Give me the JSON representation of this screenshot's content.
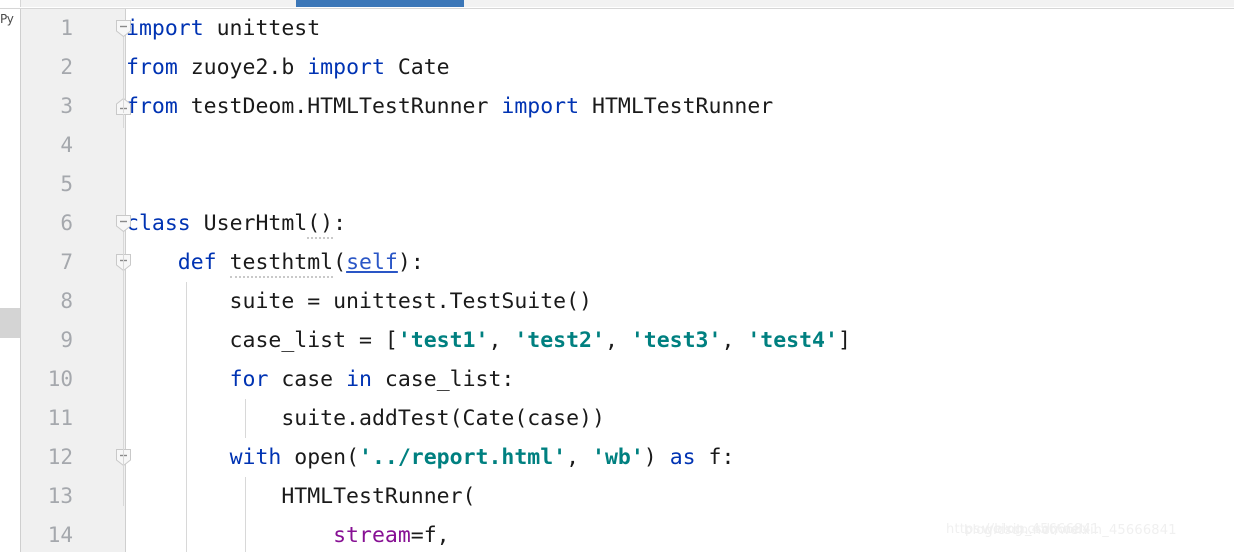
{
  "window": {
    "file_type_label": "Py",
    "accent_color": "#3c77b8",
    "gutter_bg": "#f0f0f0",
    "keyword_color": "#0033b3",
    "string_color": "#008080",
    "param_color": "#871094",
    "self_color": "#2a56c6",
    "text_color": "#1a1a1a"
  },
  "gutter": {
    "line_numbers": [
      "1",
      "2",
      "3",
      "4",
      "5",
      "6",
      "7",
      "8",
      "9",
      "10",
      "11",
      "12",
      "13",
      "14"
    ]
  },
  "code": {
    "lines": [
      {
        "number": "1",
        "fold": "minus-collapsible",
        "tokens": [
          {
            "t": "import",
            "c": "kw"
          },
          {
            "t": " unittest",
            "c": "plain"
          }
        ]
      },
      {
        "number": "2",
        "fold": "",
        "tokens": [
          {
            "t": "from",
            "c": "kw"
          },
          {
            "t": " zuoye2.b ",
            "c": "plain"
          },
          {
            "t": "import",
            "c": "kw"
          },
          {
            "t": " Cate",
            "c": "plain"
          }
        ]
      },
      {
        "number": "3",
        "fold": "minus-end",
        "tokens": [
          {
            "t": "from",
            "c": "kw"
          },
          {
            "t": " testDeom.HTMLTestRunner ",
            "c": "plain"
          },
          {
            "t": "import",
            "c": "kw"
          },
          {
            "t": " HTMLTestRunner",
            "c": "plain"
          }
        ]
      },
      {
        "number": "4",
        "fold": "",
        "tokens": []
      },
      {
        "number": "5",
        "fold": "",
        "tokens": []
      },
      {
        "number": "6",
        "fold": "minus-collapsible",
        "tokens": [
          {
            "t": "class",
            "c": "kw"
          },
          {
            "t": " UserHtml",
            "c": "plain"
          },
          {
            "t": "()",
            "c": "plain squiggle"
          },
          {
            "t": ":",
            "c": "plain"
          }
        ]
      },
      {
        "number": "7",
        "fold": "minus-collapsible",
        "tokens": [
          {
            "t": "    ",
            "c": "plain"
          },
          {
            "t": "def",
            "c": "kw"
          },
          {
            "t": " ",
            "c": "plain"
          },
          {
            "t": "testhtml",
            "c": "plain squiggle"
          },
          {
            "t": "(",
            "c": "plain"
          },
          {
            "t": "self",
            "c": "selfkw"
          },
          {
            "t": "):",
            "c": "plain"
          }
        ]
      },
      {
        "number": "8",
        "fold": "",
        "tokens": [
          {
            "t": "        suite = unittest.TestSuite()",
            "c": "plain"
          }
        ]
      },
      {
        "number": "9",
        "fold": "",
        "tokens": [
          {
            "t": "        case_list = [",
            "c": "plain"
          },
          {
            "t": "'test1'",
            "c": "str"
          },
          {
            "t": ", ",
            "c": "plain"
          },
          {
            "t": "'test2'",
            "c": "str"
          },
          {
            "t": ", ",
            "c": "plain"
          },
          {
            "t": "'test3'",
            "c": "str"
          },
          {
            "t": ", ",
            "c": "plain"
          },
          {
            "t": "'test4'",
            "c": "str"
          },
          {
            "t": "]",
            "c": "plain"
          }
        ]
      },
      {
        "number": "10",
        "fold": "",
        "tokens": [
          {
            "t": "        ",
            "c": "plain"
          },
          {
            "t": "for",
            "c": "kw"
          },
          {
            "t": " case ",
            "c": "plain"
          },
          {
            "t": "in",
            "c": "kw"
          },
          {
            "t": " case_list:",
            "c": "plain"
          }
        ]
      },
      {
        "number": "11",
        "fold": "",
        "tokens": [
          {
            "t": "            suite.addTest(Cate(case))",
            "c": "plain"
          }
        ]
      },
      {
        "number": "12",
        "fold": "minus-collapsible",
        "tokens": [
          {
            "t": "        ",
            "c": "plain"
          },
          {
            "t": "with",
            "c": "kw"
          },
          {
            "t": " open(",
            "c": "plain"
          },
          {
            "t": "'../report.html'",
            "c": "str"
          },
          {
            "t": ", ",
            "c": "plain"
          },
          {
            "t": "'wb'",
            "c": "str"
          },
          {
            "t": ") ",
            "c": "plain"
          },
          {
            "t": "as",
            "c": "kw"
          },
          {
            "t": " f:",
            "c": "plain"
          }
        ]
      },
      {
        "number": "13",
        "fold": "",
        "tokens": [
          {
            "t": "            HTMLTestRunner(",
            "c": "plain"
          }
        ]
      },
      {
        "number": "14",
        "fold": "",
        "tokens": [
          {
            "t": "                ",
            "c": "plain"
          },
          {
            "t": "stream",
            "c": "param"
          },
          {
            "t": "=f,",
            "c": "plain"
          }
        ]
      }
    ]
  },
  "watermark": {
    "line1": "https://blog.csdn.net/",
    "line2": "blog.csdn.net/weixin_45666841",
    "line3": "weixin_45666841"
  }
}
